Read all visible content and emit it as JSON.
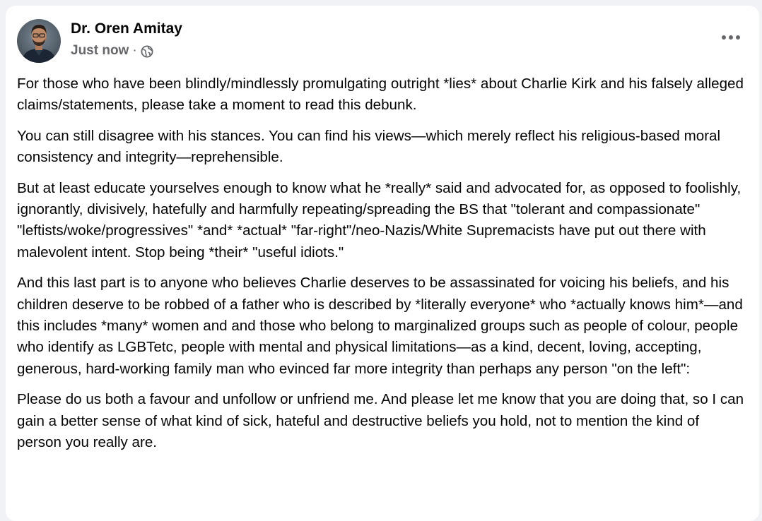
{
  "post": {
    "author": "Dr. Oren Amitay",
    "timestamp": "Just now",
    "separator": "·",
    "privacy_icon": "globe-icon",
    "menu_icon": "more-horizontal-icon",
    "paragraphs": [
      "For those who have been blindly/mindlessly promulgating outright *lies* about Charlie Kirk and his falsely alleged claims/statements, please take a moment to read this debunk.",
      "You can still disagree with his stances. You can find his views—which merely reflect his religious-based moral consistency and integrity—reprehensible.",
      "But at least educate yourselves enough to know what he *really* said and advocated for, as opposed to foolishly, ignorantly, divisively, hatefully and harmfully repeating/spreading the BS that \"tolerant and compassionate\" \"leftists/woke/progressives\" *and* *actual* \"far-right\"/neo-Nazis/White Supremacists have put out there with malevolent intent. Stop being *their* \"useful idiots.\"",
      "And this last part is to anyone who believes Charlie deserves to be assassinated for voicing his beliefs, and his children deserve to be robbed of a father who is described by *literally everyone* who *actually knows him*—and this includes *many* women and and those who belong to marginalized groups such as people of colour, people who identify as LGBTetc, people with mental and physical limitations—as a kind, decent, loving, accepting, generous, hard-working family man who evinced far more integrity than perhaps any person \"on the left\":",
      "Please do us both a favour and unfollow or unfriend me. And please let me know that you are doing that, so I can gain a better sense of what kind of sick, hateful and destructive beliefs you hold, not to mention the kind of person you really are."
    ]
  },
  "colors": {
    "page_background": "#f0f2f5",
    "card_background": "#ffffff",
    "primary_text": "#050505",
    "secondary_text": "#65676b"
  }
}
